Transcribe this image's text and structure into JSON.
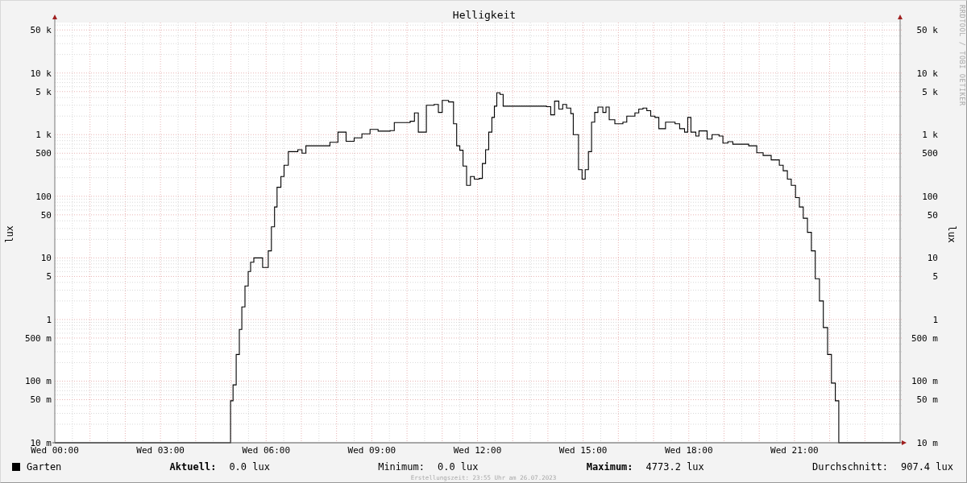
{
  "title": "Helligkeit",
  "chart": {
    "y_axis_label": "lux",
    "left_ticks": [
      "50 k",
      "10 k",
      "5 k",
      "1 k",
      "500",
      "100",
      "50",
      "10",
      "5",
      "1",
      "500 m",
      "100 m",
      "50 m",
      "10 m"
    ],
    "x_ticks": [
      "Wed 00:00",
      "Wed 03:00",
      "Wed 06:00",
      "Wed 09:00",
      "Wed 12:00",
      "Wed 15:00",
      "Wed 18:00",
      "Wed 21:00"
    ],
    "right_ticks": [
      "50 k",
      "10 k",
      "5 k",
      "1 k",
      "500",
      "100",
      "50",
      "10",
      "5",
      "1",
      "500 m",
      "100 m",
      "50 m",
      "10 m"
    ],
    "right_axis_label": "lux",
    "credit": "RRDTOOL / TOBI OETIKER"
  },
  "legend": {
    "series_name": "Garten",
    "stats": [
      {
        "label": "Aktuell:",
        "value": "0.0 lux",
        "bold": true
      },
      {
        "label": "Minimum:",
        "value": "0.0 lux",
        "bold": false
      },
      {
        "label": "Maximum:",
        "value": "4773.2 lux",
        "bold": true
      },
      {
        "label": "Durchschnitt:",
        "value": "907.4 lux",
        "bold": false
      }
    ]
  },
  "footer": "Erstellungszeit: 23:55 Uhr am 26.07.2023"
}
